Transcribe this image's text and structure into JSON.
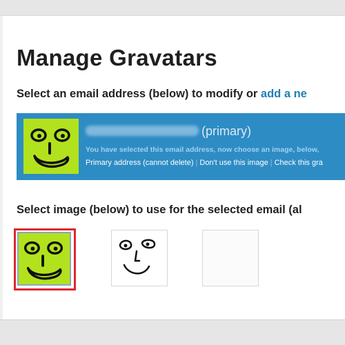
{
  "page": {
    "title": "Manage Gravatars"
  },
  "email_section": {
    "prompt": "Select an email address (below) to modify or ",
    "add_link": "add a ne",
    "entry": {
      "address_hidden": true,
      "primary_label": "(primary)",
      "notice": "You have selected this email address, now choose an image, below,",
      "actions": [
        "Primary address (cannot delete)",
        "Don't use this image",
        "Check this gra"
      ]
    }
  },
  "image_section": {
    "prompt": "Select image (below) to use for the selected email (al",
    "images": [
      {
        "icon": "smiley-face-lime",
        "background": "#b2e21d",
        "selected": true
      },
      {
        "icon": "smiley-face-sketch",
        "background": "#ffffff",
        "selected": false
      },
      {
        "icon": "blank-image",
        "background": "#ffffff",
        "selected": false
      }
    ]
  },
  "colors": {
    "accent_blue": "#2e8cc4",
    "link_blue": "#1e7fb8",
    "lime": "#b2e21d",
    "selection_red": "#e0262e"
  }
}
